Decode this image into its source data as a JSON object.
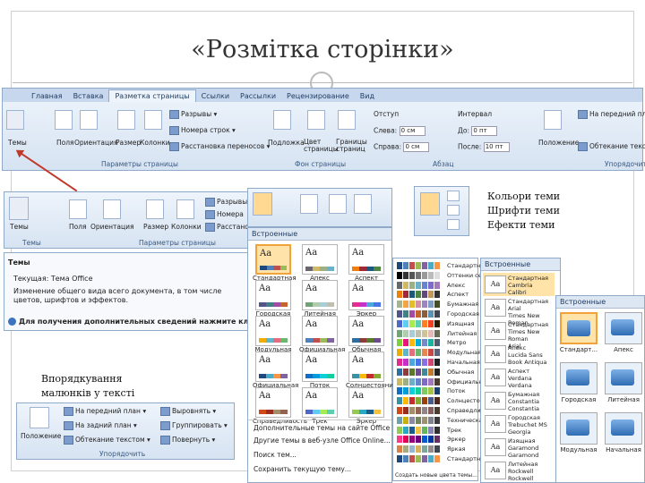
{
  "slide": {
    "title": "«Розмітка сторінки»"
  },
  "ribbon": {
    "tabs": [
      "Главная",
      "Вставка",
      "Разметка страницы",
      "Ссылки",
      "Рассылки",
      "Рецензирование",
      "Вид"
    ],
    "themes_label": "Темы",
    "buttons": {
      "fields": "Поля",
      "orientation": "Ориентация",
      "size": "Размер",
      "columns": "Колонки",
      "breaks": "Разрывы ▾",
      "line_numbers": "Номера строк ▾",
      "hyphenation": "Расстановка переносов ▾",
      "watermark": "Подложка",
      "page_color": "Цвет страницы",
      "page_borders": "Границы страниц",
      "indent": "Отступ",
      "interval": "Интервал",
      "left": "Слева:",
      "right": "Справа:",
      "before": "До:",
      "after": "После:",
      "left_val": "0 см",
      "right_val": "0 см",
      "before_val": "0 пт",
      "after_val": "10 пт",
      "position": "Положение",
      "front": "На передний план",
      "text_wrap": "Обтекание текстом"
    },
    "groups": {
      "page_setup": "Параметры страницы",
      "page_bg": "Фон страницы",
      "paragraph": "Абзац",
      "arrange": "Упорядочить"
    }
  },
  "zoom_ribbon": {
    "themes": "Темы",
    "fields": "Поля",
    "orientation": "Ориентация",
    "size": "Размер",
    "columns": "Колонки",
    "breaks": "Разрывы",
    "line_numbers": "Номера",
    "hyphenation": "Расстано",
    "group_themes": "Темы",
    "group_page_setup": "Параметры страницы"
  },
  "tooltip": {
    "title": "Темы",
    "current": "Текущая: Тема Office",
    "body": "Изменение общего вида всего документа, в том числе цветов, шрифтов и эффектов.",
    "help": "Для получения дополнительных сведений нажмите клавишу"
  },
  "themes_gallery": {
    "header": "Встроенные",
    "items": [
      {
        "name": "Стандартная",
        "colors": [
          "#1f497d",
          "#4f81bd",
          "#c0504d",
          "#9bbb59"
        ],
        "selected": true
      },
      {
        "name": "Апекс",
        "colors": [
          "#69676d",
          "#ceb966",
          "#9cb084",
          "#6bb1c9"
        ],
        "selected": false
      },
      {
        "name": "Аспект",
        "colors": [
          "#f07f09",
          "#9f2936",
          "#1b587c",
          "#4e8542"
        ],
        "selected": false
      },
      {
        "name": "Городская",
        "colors": [
          "#53548a",
          "#438086",
          "#a04da3",
          "#c4652d"
        ],
        "selected": false
      },
      {
        "name": "Литейная",
        "colors": [
          "#72a376",
          "#b0ccb0",
          "#a8cdd7",
          "#c0beaf"
        ],
        "selected": false
      },
      {
        "name": "Эркер",
        "colors": [
          "#e32d91",
          "#c830cc",
          "#4ea6dc",
          "#4775e7"
        ],
        "selected": false
      },
      {
        "name": "Модульная",
        "colors": [
          "#f0ad00",
          "#60b5cc",
          "#e66c7d",
          "#6bb76d"
        ],
        "selected": false
      },
      {
        "name": "Официальная",
        "colors": [
          "#4f81bd",
          "#c0504d",
          "#9bbb59",
          "#8064a2"
        ],
        "selected": false
      },
      {
        "name": "Обычная",
        "colors": [
          "#2c6fa3",
          "#8f3b3b",
          "#5a7a2b",
          "#6e4b8c"
        ],
        "selected": false
      },
      {
        "name": "Официальная",
        "colors": [
          "#1f497d",
          "#4bacc6",
          "#f79646",
          "#8064a2"
        ],
        "selected": false
      },
      {
        "name": "Поток",
        "colors": [
          "#0f6fc6",
          "#009dd9",
          "#0bd0d9",
          "#10cf9b"
        ],
        "selected": false
      },
      {
        "name": "Солнцестояние",
        "colors": [
          "#3891a7",
          "#feb80a",
          "#c32d2e",
          "#84aa33"
        ],
        "selected": false
      },
      {
        "name": "Справедливость",
        "colors": [
          "#d34817",
          "#9b2d1f",
          "#a28e6a",
          "#956251"
        ],
        "selected": false
      },
      {
        "name": "Трек",
        "colors": [
          "#4e67c8",
          "#5eccf3",
          "#a7ea52",
          "#5dceaf"
        ],
        "selected": false
      },
      {
        "name": "Эркер",
        "colors": [
          "#94c954",
          "#29a8c4",
          "#1a5b8c",
          "#f4c242"
        ],
        "selected": false
      }
    ],
    "menu": [
      "Дополнительные темы на сайте Office Online...",
      "Другие темы в веб-узле Office Online...",
      "Поиск тем...",
      "Сохранить текущую тему..."
    ]
  },
  "colors_gallery": {
    "items": [
      {
        "name": "Стандартная",
        "colors": [
          "#1f497d",
          "#4f81bd",
          "#c0504d",
          "#9bbb59",
          "#8064a2",
          "#4bacc6",
          "#f79646"
        ]
      },
      {
        "name": "Оттенки серого",
        "colors": [
          "#000000",
          "#333333",
          "#555555",
          "#777777",
          "#999999",
          "#bbbbbb",
          "#dddddd"
        ]
      },
      {
        "name": "Апекс",
        "colors": [
          "#69676d",
          "#ceb966",
          "#9cb084",
          "#6bb1c9",
          "#6585cf",
          "#7e6bc9",
          "#a379bb"
        ]
      },
      {
        "name": "Аспект",
        "colors": [
          "#f07f09",
          "#9f2936",
          "#1b587c",
          "#4e8542",
          "#604878",
          "#c19859",
          "#323232"
        ]
      },
      {
        "name": "Бумажная",
        "colors": [
          "#a5b592",
          "#f3a447",
          "#e7bc29",
          "#d092a7",
          "#9c85c0",
          "#809ec2",
          "#444d26"
        ]
      },
      {
        "name": "Городская",
        "colors": [
          "#53548a",
          "#438086",
          "#a04da3",
          "#c4652d",
          "#8b5d3d",
          "#5c92b5",
          "#424456"
        ]
      },
      {
        "name": "Изящная",
        "colors": [
          "#4e67c8",
          "#5eccf3",
          "#a7ea52",
          "#5dceaf",
          "#ff8021",
          "#f14124",
          "#2a1a00"
        ]
      },
      {
        "name": "Литейная",
        "colors": [
          "#72a376",
          "#b0ccb0",
          "#a8cdd7",
          "#c0beaf",
          "#cec597",
          "#e8b7b7",
          "#676a55"
        ]
      },
      {
        "name": "Метро",
        "colors": [
          "#7fd13b",
          "#ea157a",
          "#feb80a",
          "#00addc",
          "#738ac8",
          "#1ab39f",
          "#4e5b6f"
        ]
      },
      {
        "name": "Модульная",
        "colors": [
          "#f0ad00",
          "#60b5cc",
          "#e66c7d",
          "#6bb76d",
          "#e88651",
          "#c64847",
          "#5a6378"
        ]
      },
      {
        "name": "Начальная",
        "colors": [
          "#e32d91",
          "#c830cc",
          "#4ea6dc",
          "#4775e7",
          "#8971e1",
          "#d54773",
          "#1f2123"
        ]
      },
      {
        "name": "Обычная",
        "colors": [
          "#2c6fa3",
          "#8f3b3b",
          "#5a7a2b",
          "#6e4b8c",
          "#3e8a9a",
          "#c47a2c",
          "#222222"
        ]
      },
      {
        "name": "Официальная",
        "colors": [
          "#ceb966",
          "#9cb084",
          "#6bb1c9",
          "#6585cf",
          "#7e6bc9",
          "#a379bb",
          "#4e3b30"
        ]
      },
      {
        "name": "Поток",
        "colors": [
          "#0f6fc6",
          "#009dd9",
          "#0bd0d9",
          "#10cf9b",
          "#7cca62",
          "#a5c249",
          "#17406d"
        ]
      },
      {
        "name": "Солнцестояние",
        "colors": [
          "#3891a7",
          "#feb80a",
          "#c32d2e",
          "#84aa33",
          "#964305",
          "#475a8d",
          "#4f271c"
        ]
      },
      {
        "name": "Справедливость",
        "colors": [
          "#d34817",
          "#9b2d1f",
          "#a28e6a",
          "#956251",
          "#918485",
          "#855d5d",
          "#4e3b30"
        ]
      },
      {
        "name": "Техническая",
        "colors": [
          "#6ea0b0",
          "#ccaf0a",
          "#8d89a4",
          "#748560",
          "#9e9273",
          "#7e848d",
          "#3b3b3b"
        ]
      },
      {
        "name": "Трек",
        "colors": [
          "#94c954",
          "#29a8c4",
          "#1a5b8c",
          "#f4c242",
          "#65b55a",
          "#8a84b6",
          "#303030"
        ]
      },
      {
        "name": "Эркер",
        "colors": [
          "#ff388c",
          "#e40059",
          "#9c007f",
          "#68007f",
          "#005bd3",
          "#00349e",
          "#632e62"
        ]
      },
      {
        "name": "Яркая",
        "colors": [
          "#dd8047",
          "#a5ab81",
          "#94b6d2",
          "#d8b25c",
          "#7ba79d",
          "#968c8c",
          "#414751"
        ]
      },
      {
        "name": "Стандартная",
        "colors": [
          "#1f497d",
          "#4f81bd",
          "#c0504d",
          "#9bbb59",
          "#8064a2",
          "#4bacc6",
          "#f79646"
        ]
      }
    ],
    "footer": "Создать новые цвета темы..."
  },
  "fonts_gallery": {
    "header": "Встроенные",
    "items": [
      {
        "aa": "Aa",
        "l1": "Стандартная",
        "l2": "Cambria",
        "l3": "Calibri",
        "selected": true
      },
      {
        "aa": "Aa",
        "l1": "Стандартная",
        "l2": "Arial",
        "l3": "Times New Roman",
        "selected": false
      },
      {
        "aa": "Aa",
        "l1": "Стандартная",
        "l2": "Times New Roman",
        "l3": "Arial",
        "selected": false
      },
      {
        "aa": "Aa",
        "l1": "Апекс",
        "l2": "Lucida Sans",
        "l3": "Book Antiqua",
        "selected": false
      },
      {
        "aa": "Aa",
        "l1": "Аспект",
        "l2": "Verdana",
        "l3": "Verdana",
        "selected": false
      },
      {
        "aa": "Aa",
        "l1": "Бумажная",
        "l2": "Constantia",
        "l3": "Constantia",
        "selected": false
      },
      {
        "aa": "Aa",
        "l1": "Городская",
        "l2": "Trebuchet MS",
        "l3": "Georgia",
        "selected": false
      },
      {
        "aa": "Aa",
        "l1": "Изящная",
        "l2": "Garamond",
        "l3": "Garamond",
        "selected": false
      },
      {
        "aa": "Aa",
        "l1": "Литейная",
        "l2": "Rockwell",
        "l3": "Rockwell",
        "selected": false
      }
    ]
  },
  "effects_gallery": {
    "header": "Встроенные",
    "items": [
      {
        "name": "Стандарт...",
        "selected": true
      },
      {
        "name": "Апекс",
        "selected": false
      },
      {
        "name": "Городская",
        "selected": false
      },
      {
        "name": "Литейная",
        "selected": false
      },
      {
        "name": "Модульная",
        "selected": false
      },
      {
        "name": "Начальная",
        "selected": false
      }
    ]
  },
  "arrange_panel": {
    "position": "Положение",
    "front": "На передний план ▾",
    "back": "На задний план ▾",
    "wrap": "Обтекание текстом ▾",
    "align": "Выровнять ▾",
    "group": "Группировать ▾",
    "rotate": "Повернуть ▾",
    "group_label": "Упорядочить"
  },
  "captions": {
    "theme_parts_1": "Кольори теми",
    "theme_parts_2": "Шрифти  теми",
    "theme_parts_3": "Ефекти теми",
    "arrange_1": "Впорядкування",
    "arrange_2": "малюнків у тексті"
  }
}
